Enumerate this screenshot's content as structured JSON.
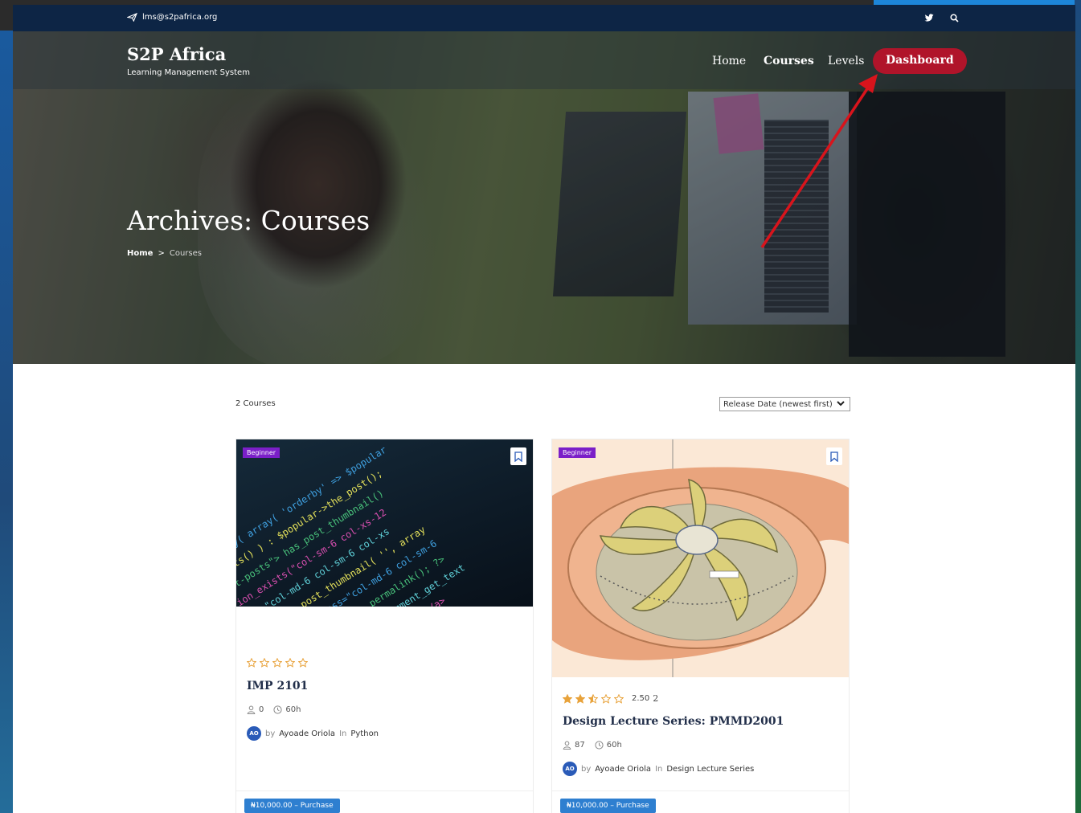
{
  "colors": {
    "topbar": "#0d2545",
    "dashboard": "#b0142a",
    "badge": "#7b1fc8",
    "purchase": "#2e7fd0",
    "star": "#e8a23a"
  },
  "topbar": {
    "email": "lms@s2pafrica.org",
    "icons": [
      "send-icon",
      "twitter-icon",
      "search-icon"
    ]
  },
  "site": {
    "name": "S2P Africa",
    "tagline": "Learning Management System"
  },
  "nav": {
    "items": [
      "Home",
      "Courses",
      "Levels"
    ],
    "dashboard": "Dashboard",
    "active": "Courses"
  },
  "hero": {
    "title": "Archives: Courses",
    "breadcrumb": {
      "home": "Home",
      "separator": ">",
      "current": "Courses"
    }
  },
  "listing": {
    "count": "2 Courses",
    "sort": "Release Date (newest first)"
  },
  "courses": [
    {
      "badge": "Beginner",
      "rating_value": 0,
      "title": "IMP 2101",
      "students": "0",
      "duration": "60h",
      "author_initials": "AO",
      "by": "by",
      "author": "Ayoade Oriola",
      "in": "In",
      "category": "Python",
      "price": "₦10,000.00 – Purchase"
    },
    {
      "badge": "Beginner",
      "rating_value": 2.5,
      "rating_text": "2.50",
      "rating_count": "2",
      "title": "Design Lecture Series: PMMD2001",
      "students": "87",
      "duration": "60h",
      "author_initials": "AO",
      "by": "by",
      "author": "Ayoade Oriola",
      "in": "In",
      "category": "Design Lecture Series",
      "price": "₦10,000.00 – Purchase"
    }
  ]
}
